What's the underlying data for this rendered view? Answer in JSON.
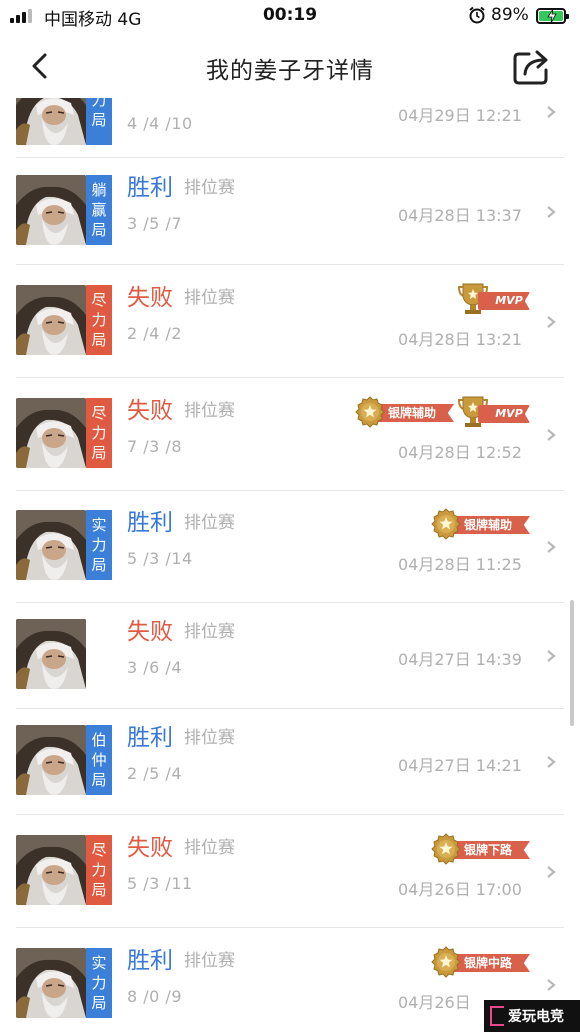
{
  "status_bar": {
    "carrier": "中国移动  4G",
    "time": "00:19",
    "battery": "89%"
  },
  "header": {
    "title": "我的姜子牙详情"
  },
  "mode_label": "排位赛",
  "rows": [
    {
      "result": "",
      "kda": "4 /4 /10",
      "time": "04月29日 12:21",
      "tag": [
        "力",
        "局"
      ],
      "tag_color": "blue",
      "outcome": "none"
    },
    {
      "result": "胜利",
      "kda": "3 /5 /7",
      "time": "04月28日 13:37",
      "tag": [
        "躺",
        "赢",
        "局"
      ],
      "tag_color": "blue",
      "outcome": "win",
      "badges": []
    },
    {
      "result": "失败",
      "kda": "2 /4 /2",
      "time": "04月28日 13:21",
      "tag": [
        "尽",
        "力",
        "局"
      ],
      "tag_color": "red",
      "outcome": "lose",
      "badges": [
        "MVP"
      ]
    },
    {
      "result": "失败",
      "kda": "7 /3 /8",
      "time": "04月28日 12:52",
      "tag": [
        "尽",
        "力",
        "局"
      ],
      "tag_color": "red",
      "outcome": "lose",
      "badges": [
        "银牌辅助",
        "MVP"
      ]
    },
    {
      "result": "胜利",
      "kda": "5 /3 /14",
      "time": "04月28日 11:25",
      "tag": [
        "实",
        "力",
        "局"
      ],
      "tag_color": "blue",
      "outcome": "win",
      "badges": [
        "银牌辅助"
      ]
    },
    {
      "result": "失败",
      "kda": "3 /6 /4",
      "time": "04月27日 14:39",
      "tag": [],
      "tag_color": "none",
      "outcome": "lose",
      "badges": []
    },
    {
      "result": "胜利",
      "kda": "2 /5 /4",
      "time": "04月27日 14:21",
      "tag": [
        "伯",
        "仲",
        "局"
      ],
      "tag_color": "blue",
      "outcome": "win",
      "badges": []
    },
    {
      "result": "失败",
      "kda": "5 /3 /11",
      "time": "04月26日 17:00",
      "tag": [
        "尽",
        "力",
        "局"
      ],
      "tag_color": "red",
      "outcome": "lose",
      "badges": [
        "银牌下路"
      ]
    },
    {
      "result": "胜利",
      "kda": "8 /0 /9",
      "time": "04月26日",
      "tag": [
        "实",
        "力",
        "局"
      ],
      "tag_color": "blue",
      "outcome": "win",
      "badges": [
        "银牌中路"
      ]
    }
  ],
  "watermark": "爱玩电竞",
  "colors": {
    "win": "#3a78d8",
    "lose": "#e05a42",
    "muted": "#b0b0b0",
    "badge_ribbon": "#d9604a"
  }
}
